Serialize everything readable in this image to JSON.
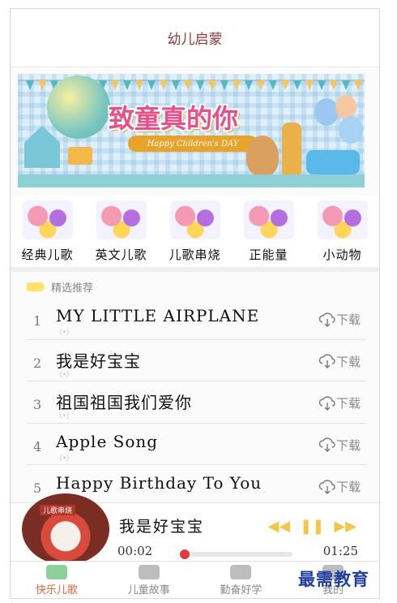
{
  "header": {
    "title": "幼儿启蒙"
  },
  "banner": {
    "headline": "致童真的你",
    "ribbon": "Happy Children's DAY"
  },
  "categories": [
    {
      "label": "经典儿歌"
    },
    {
      "label": "英文儿歌"
    },
    {
      "label": "儿歌串烧"
    },
    {
      "label": "正能量"
    },
    {
      "label": "小动物"
    }
  ],
  "recommended": {
    "title": "精选推荐",
    "download_label": "下载",
    "songs": [
      {
        "num": "1",
        "title": "MY LITTLE AIRPLANE"
      },
      {
        "num": "2",
        "title": "我是好宝宝"
      },
      {
        "num": "3",
        "title": "祖国祖国我们爱你"
      },
      {
        "num": "4",
        "title": "Apple Song"
      },
      {
        "num": "5",
        "title": "Happy Birthday To You"
      }
    ]
  },
  "player": {
    "album_label": "儿歌串烧",
    "title": "我是好宝宝",
    "current_time": "00:02",
    "total_time": "01:25",
    "progress": 0.02,
    "controls": {
      "prev": "◀◀",
      "pause": "❚❚",
      "next": "▶▶"
    },
    "accent_color": "#f0c94a"
  },
  "tabs": [
    {
      "label": "快乐儿歌",
      "active": true
    },
    {
      "label": "儿童故事",
      "active": false
    },
    {
      "label": "勤奋好学",
      "active": false
    },
    {
      "label": "我的",
      "active": false
    }
  ],
  "watermark": "最需教育"
}
